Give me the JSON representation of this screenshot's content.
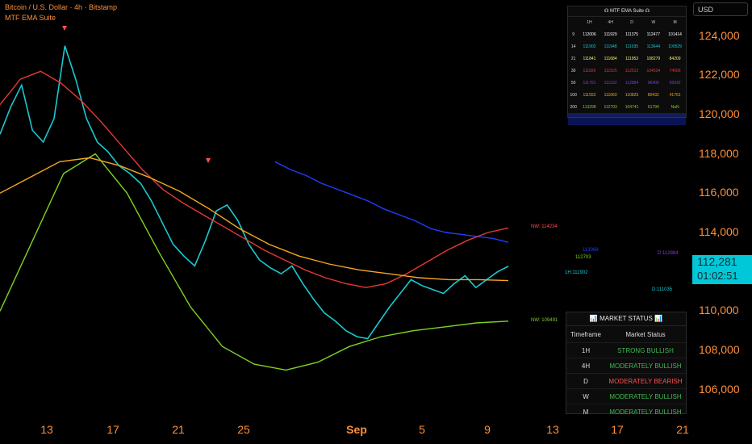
{
  "header": {
    "title": "Bitcoin / U.S. Dollar · 4h · Bitstamp",
    "indicator": "MTF EMA Suite"
  },
  "currency": "USD",
  "ema_table": {
    "title": "☊ MTF EMA Suite ☊",
    "columns": [
      "",
      "1H",
      "4H",
      "D",
      "W",
      "M"
    ],
    "rows": [
      {
        "len": "9",
        "color": "#ffffff",
        "values": [
          "112006",
          "111929",
          "111375",
          "112477",
          "101414"
        ]
      },
      {
        "len": "14",
        "color": "#19c9d1",
        "values": [
          "111902",
          "111948",
          "111035",
          "113644",
          "100529"
        ]
      },
      {
        "len": "21",
        "color": "#fff176",
        "values": [
          "111841",
          "111684",
          "111953",
          "108279",
          "84209"
        ]
      },
      {
        "len": "30",
        "color": "#e53935",
        "values": [
          "111820",
          "111525",
          "112512",
          "104534",
          "74066"
        ]
      },
      {
        "len": "50",
        "color": "#7e3fd6",
        "values": [
          "111761",
          "111232",
          "112884",
          "96400",
          "69932"
        ]
      },
      {
        "len": "100",
        "color": "#f5a623",
        "values": [
          "111552",
          "111660",
          "110825",
          "80432",
          "41761"
        ]
      },
      {
        "len": "200",
        "color": "#7ed321",
        "values": [
          "113298",
          "112703",
          "104741",
          "61794",
          "NaN"
        ]
      },
      {
        "len": "",
        "color": "#1f3dff",
        "values": [
          "",
          "",
          "",
          "",
          ""
        ]
      }
    ]
  },
  "status_table": {
    "title": "📊 MARKET STATUS 📊",
    "headers": [
      "Timeframe",
      "Market Status"
    ],
    "rows": [
      {
        "tf": "1H",
        "status": "STRONG BULLISH",
        "color": "#3fb950"
      },
      {
        "tf": "4H",
        "status": "MODERATELY BULLISH",
        "color": "#3fb950"
      },
      {
        "tf": "D",
        "status": "MODERATELY BEARISH",
        "color": "#ff5252"
      },
      {
        "tf": "W",
        "status": "MODERATELY BULLISH",
        "color": "#3fb950"
      },
      {
        "tf": "M",
        "status": "MODERATELY BULLISH",
        "color": "#3fb950"
      }
    ]
  },
  "price_axis": {
    "labels": [
      "124,000",
      "122,000",
      "120,000",
      "118,000",
      "116,000",
      "114,000",
      "112,000",
      "110,000",
      "108,000",
      "106,000"
    ],
    "values": [
      124000,
      122000,
      120000,
      118000,
      116000,
      114000,
      112000,
      110000,
      108000,
      106000
    ],
    "accent_color": "#ff8f3a"
  },
  "last_price": {
    "price": "112,281",
    "countdown": "01:02:51",
    "color": "#00c8d8"
  },
  "time_axis": {
    "labels": [
      "13",
      "17",
      "21",
      "25",
      "Sep",
      "5",
      "9",
      "13",
      "17",
      "21"
    ],
    "bold": [
      "Sep"
    ]
  },
  "chart_tags": [
    {
      "text": "NW: 114234",
      "color": "#ff5252",
      "value": 114234
    },
    {
      "text": "112703",
      "color": "#7ed321",
      "value": 112703
    },
    {
      "text": "D:112884",
      "color": "#7e3fd6",
      "value": 112884
    },
    {
      "text": "113068",
      "color": "#1f3dff",
      "value": 113068
    },
    {
      "text": "D:111035",
      "color": "#19c9d1",
      "value": 111035
    },
    {
      "text": "NW: 109491",
      "color": "#7ed321",
      "value": 109491
    },
    {
      "text": "1H:111902",
      "color": "#19c9d1",
      "value": 111902
    }
  ],
  "chart_data": {
    "type": "line",
    "title": "Bitcoin / U.S. Dollar · 4h · Bitstamp",
    "ylim": [
      104800,
      125500
    ],
    "x_ticks": [
      "13",
      "17",
      "21",
      "25",
      "Sep",
      "5",
      "9",
      "13",
      "17",
      "21"
    ],
    "series": [
      {
        "name": "price",
        "color": "#19c9d1",
        "values": [
          119000,
          120400,
          121500,
          119200,
          118600,
          119800,
          123500,
          121800,
          119800,
          118600,
          118100,
          117400,
          117000,
          116500,
          115600,
          114500,
          113400,
          112800,
          112300,
          113600,
          115100,
          115400,
          114600,
          113400,
          112600,
          112200,
          111900,
          112300,
          111400,
          110600,
          109900,
          109500,
          109000,
          108700,
          108600,
          109400,
          110200,
          110900,
          111600,
          111300,
          111100,
          110900,
          111400,
          111800,
          111200,
          111600,
          112000,
          112281
        ]
      },
      {
        "name": "",
        "color": "#1f3dff",
        "values": [
          null,
          null,
          null,
          null,
          null,
          null,
          null,
          null,
          null,
          null,
          null,
          null,
          null,
          117600,
          117200,
          116900,
          116500,
          116200,
          115900,
          115600,
          115200,
          114900,
          114600,
          114200,
          114000,
          113900,
          113800,
          113700,
          113500
        ]
      },
      {
        "name": "",
        "color": "#e53935",
        "values": [
          120500,
          121800,
          122200,
          121600,
          120700,
          119600,
          118400,
          117200,
          116200,
          115500,
          114900,
          114300,
          113700,
          113100,
          112600,
          112100,
          111700,
          111400,
          111200,
          111400,
          111900,
          112500,
          113100,
          113600,
          114000,
          114234
        ]
      },
      {
        "name": "",
        "color": "#7ed321",
        "values": [
          110000,
          113500,
          117000,
          118000,
          116000,
          113000,
          110200,
          108200,
          107300,
          107000,
          107400,
          108200,
          108700,
          109000,
          109200,
          109400,
          109491
        ]
      },
      {
        "name": "",
        "color": "#f5a623",
        "values": [
          116000,
          116800,
          117600,
          117800,
          117400,
          116800,
          116100,
          115200,
          114200,
          113400,
          112800,
          112400,
          112100,
          111900,
          111700,
          111600,
          111600,
          111552
        ]
      }
    ]
  }
}
